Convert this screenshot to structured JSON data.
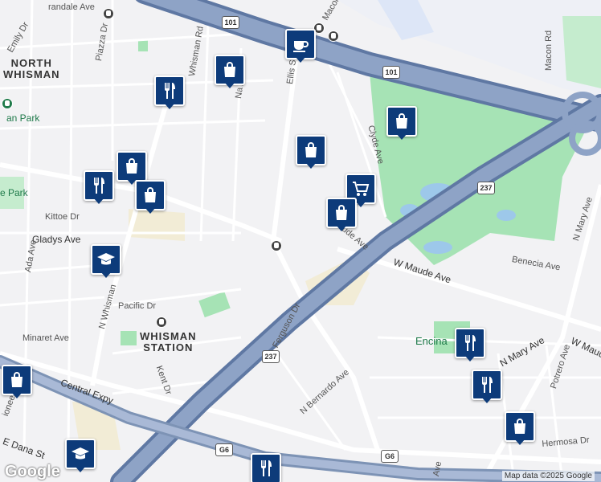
{
  "map": {
    "attribution": "Map data ©2025 Google",
    "logo": "Google",
    "colors": {
      "background": "#f2f2f4",
      "park": "#a6e3b5",
      "water": "#9dc8ea",
      "freeway": "#7d93b5",
      "road": "#ffffff",
      "pin": "#0d3b7a",
      "airfield": "#eef0f6"
    }
  },
  "labels": {
    "north_whisman": "NORTH\nWHISMAN",
    "whisman_station": "WHISMAN\nSTATION",
    "encina": "Encina",
    "an_park": "an Park",
    "e_park": "e Park",
    "streets": {
      "randale_ave": "randale Ave",
      "emily_dr": "Emily Dr",
      "piazza_dr": "Piazza Dr",
      "whisman_rd": "Whisman Rd",
      "n_whisman": "N Whisman",
      "ellis_st": "Ellis St",
      "macon_rd_top": "Macon Rd",
      "macon_rd": "Macon Rd",
      "clyde_ave": "Clyde Ave",
      "kittoe_dr": "Kittoe Dr",
      "gladys_ave": "Gladys Ave",
      "ada_ave": "Ada Ave",
      "pacific_dr": "Pacific Dr",
      "minaret_ave": "Minaret Ave",
      "central_expy": "Central Expy",
      "e_dana_st": "E Dana St",
      "ferguson_dr": "Ferguson Dr",
      "n_bernardo_ave": "N Bernardo Ave",
      "w_maude_ave": "W Maude Ave",
      "maude_ave_short": "ude Ave",
      "benecia_ave": "Benecia Ave",
      "n_mary_ave_top": "N Mary Ave",
      "n_mary_ave": "N Mary Ave",
      "w_maude_right": "W Maude",
      "potrero_ave": "Potrero Ave",
      "hermosa_dr": "Hermosa Dr",
      "kent_dr": "Kent Dr",
      "pioneer": "ioneer",
      "ave_bottom": "Ave",
      "na_ave": "Na  Ave"
    },
    "shields": {
      "us101_a": "101",
      "us101_b": "101",
      "ca237_a": "237",
      "ca237_b": "237",
      "g6_a": "G6",
      "g6_b": "G6"
    }
  },
  "pins": [
    {
      "id": "cafe-1",
      "icon": "coffee-icon"
    },
    {
      "id": "shopping-1",
      "icon": "shopping-bag-icon"
    },
    {
      "id": "restaurant-1",
      "icon": "fork-knife-icon"
    },
    {
      "id": "shopping-2",
      "icon": "shopping-bag-icon"
    },
    {
      "id": "shopping-3",
      "icon": "shopping-bag-icon"
    },
    {
      "id": "grocery-1",
      "icon": "shopping-cart-icon"
    },
    {
      "id": "shopping-4",
      "icon": "shopping-bag-icon"
    },
    {
      "id": "shopping-5",
      "icon": "shopping-bag-icon"
    },
    {
      "id": "restaurant-2",
      "icon": "fork-knife-icon"
    },
    {
      "id": "shopping-6",
      "icon": "shopping-bag-icon"
    },
    {
      "id": "school-1",
      "icon": "graduation-cap-icon"
    },
    {
      "id": "restaurant-3",
      "icon": "fork-knife-icon"
    },
    {
      "id": "restaurant-4",
      "icon": "fork-knife-icon"
    },
    {
      "id": "shopping-7",
      "icon": "shopping-bag-icon"
    },
    {
      "id": "shopping-8",
      "icon": "shopping-bag-icon"
    },
    {
      "id": "school-2",
      "icon": "graduation-cap-icon"
    },
    {
      "id": "restaurant-5",
      "icon": "fork-knife-icon"
    }
  ]
}
